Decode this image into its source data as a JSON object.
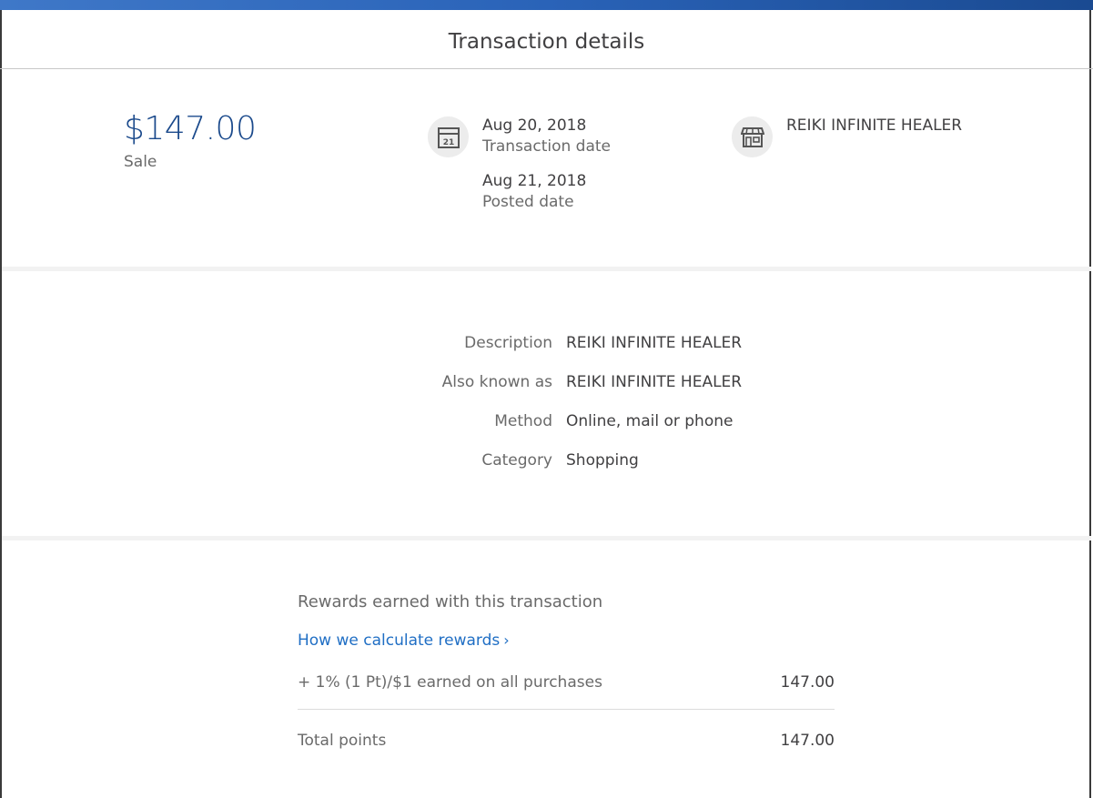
{
  "header": {
    "title": "Transaction details"
  },
  "summary": {
    "amount": "$147.00",
    "type": "Sale",
    "transaction_date": "Aug 20, 2018",
    "transaction_date_label": "Transaction date",
    "posted_date": "Aug 21, 2018",
    "posted_date_label": "Posted date",
    "calendar_icon": "calendar-icon",
    "calendar_day": "21",
    "merchant_icon": "storefront-icon",
    "merchant": "REIKI INFINITE HEALER"
  },
  "details": [
    {
      "label": "Description",
      "value": "REIKI INFINITE HEALER"
    },
    {
      "label": "Also known as",
      "value": "REIKI INFINITE HEALER"
    },
    {
      "label": "Method",
      "value": "Online, mail or phone"
    },
    {
      "label": "Category",
      "value": "Shopping"
    }
  ],
  "rewards": {
    "title": "Rewards earned with this transaction",
    "link_label": "How we calculate rewards",
    "rows": [
      {
        "label": "+ 1% (1 Pt)/$1 earned on all purchases",
        "value": "147.00"
      },
      {
        "label": "Total points",
        "value": "147.00"
      }
    ]
  },
  "colors": {
    "accent": "#1b4a8c",
    "link": "#1f6ec4",
    "brand_bar": "#2a63b8"
  }
}
